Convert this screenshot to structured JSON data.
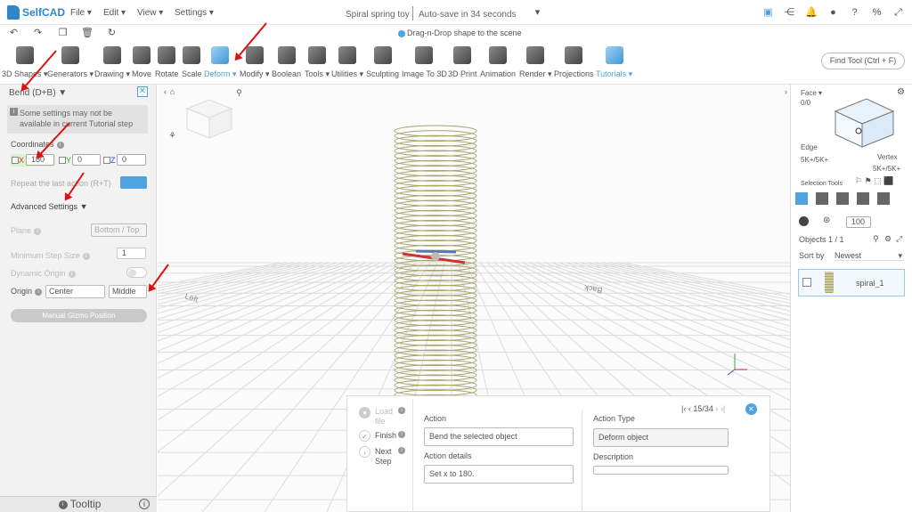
{
  "app": {
    "logo": "SelfCAD"
  },
  "menu": [
    "File ▾",
    "Edit ▾",
    "View ▾",
    "Settings ▾"
  ],
  "project": {
    "name": "Spiral spring toy",
    "autosave": "Auto-save in 34 seconds"
  },
  "hint": "Drag-n-Drop shape to the scene",
  "tools": [
    "3D Shapes ▾",
    "Generators ▾",
    "Drawing ▾",
    "Move",
    "Rotate",
    "Scale",
    "Deform ▾",
    "Modify ▾",
    "Boolean",
    "Tools ▾",
    "Utilities ▾",
    "Sculpting",
    "Image To 3D",
    "3D Print",
    "Animation",
    "Render ▾",
    "Projections",
    "Tutorials ▾"
  ],
  "find_tool": "Find Tool (Ctrl + F)",
  "left": {
    "title": "Bend (D+B)",
    "info": "Some settings may not be available in current Tutorial step",
    "coordinates": "Coordinates",
    "x_label": "X",
    "x_value": "180",
    "y_label": "Y",
    "y_value": "0",
    "z_label": "Z",
    "z_value": "0",
    "repeat": "Repeat the last action (R+T)",
    "advanced": "Advanced Settings",
    "plane": "Plane",
    "plane_value": "Bottom / Top",
    "min_step": "Minimum Step Size",
    "min_step_value": "1",
    "dynamic_origin": "Dynamic Origin",
    "origin": "Origin",
    "origin_value1": "Center",
    "origin_value2": "Middle",
    "manual_gizmo": "Manual Gizmo Position",
    "tooltip": "Tooltip"
  },
  "right": {
    "face": "Face",
    "face_count": "0/0",
    "edge": "Edge",
    "edge_count": "5K+/5K+",
    "vertex": "Vertex",
    "vertex_count": "5K+/5K+",
    "selection_tools": "Selection Tools",
    "opacity": "100",
    "objects": "Objects 1 / 1",
    "sort_by": "Sort by",
    "sort_value": "Newest",
    "object_name": "spiral_1"
  },
  "viewport": {
    "ground_label_left": "Left",
    "ground_label_back": "Back"
  },
  "tutorial": {
    "steps": [
      "Load file",
      "Finish",
      "Next Step"
    ],
    "pager": "15/34",
    "action_label": "Action",
    "action_value": "Bend the selected object",
    "details_label": "Action details",
    "details_value": "Set x to 180.",
    "type_label": "Action Type",
    "type_value": "Deform object",
    "description_label": "Description",
    "description_value": ""
  },
  "colors": {
    "accent": "#4fa3de",
    "arrow": "#e01010",
    "spring": "#a7a56d"
  }
}
